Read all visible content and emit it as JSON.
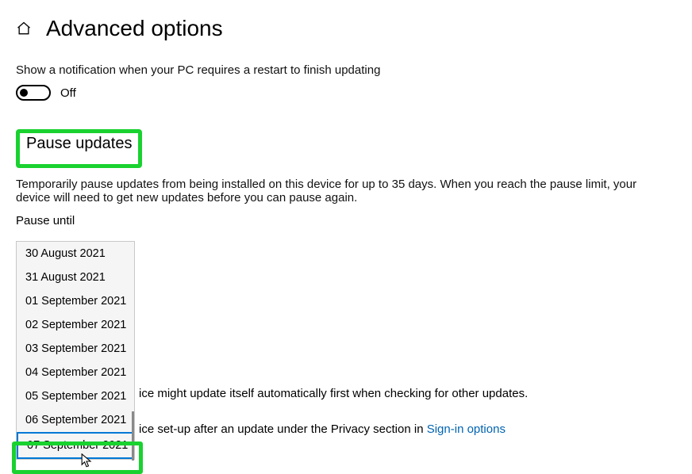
{
  "header": {
    "title": "Advanced options"
  },
  "notification": {
    "description": "Show a notification when your PC requires a restart to finish updating",
    "toggle_state": "Off"
  },
  "pause": {
    "section_title": "Pause updates",
    "description": "Temporarily pause updates from being installed on this device for up to 35 days. When you reach the pause limit, your device will need to get new updates before you can pause again.",
    "field_label": "Pause until",
    "options": [
      "30 August 2021",
      "31 August 2021",
      "01 September 2021",
      "02 September 2021",
      "03 September 2021",
      "04 September 2021",
      "05 September 2021",
      "06 September 2021",
      "07 September 2021"
    ]
  },
  "behind": {
    "line1_fragment": "ice might update itself automatically first when checking for other updates.",
    "line2_prefix": "ice set-up after an update under the Privacy section in ",
    "line2_link": "Sign-in options"
  }
}
